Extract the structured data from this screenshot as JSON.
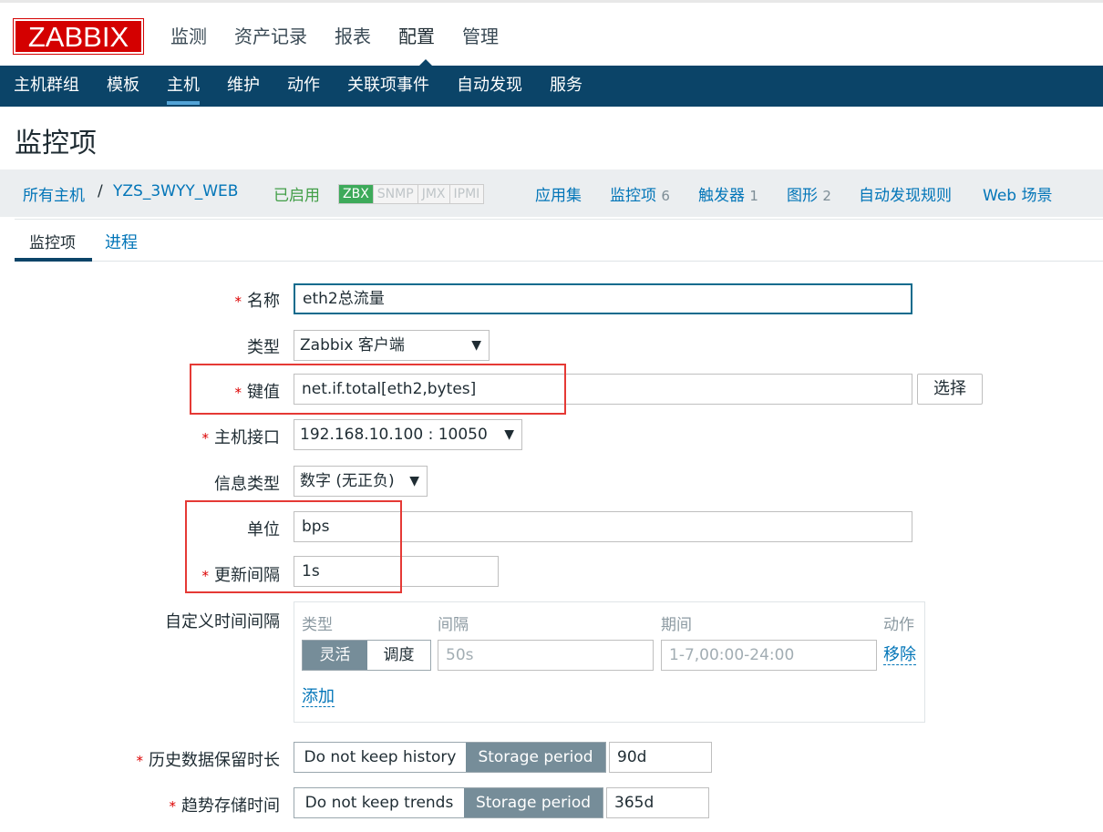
{
  "logo": "ZABBIX",
  "topnav": [
    "监测",
    "资产记录",
    "报表",
    "配置",
    "管理"
  ],
  "subnav": [
    "主机群组",
    "模板",
    "主机",
    "维护",
    "动作",
    "关联项事件",
    "自动发现",
    "服务"
  ],
  "page_title": "监控项",
  "breadcrumb": {
    "all_hosts": "所有主机",
    "sep": "/",
    "host": "YZS_3WYY_WEB",
    "enabled": "已启用",
    "badges": [
      "ZBX",
      "SNMP",
      "JMX",
      "IPMI"
    ],
    "apps": "应用集",
    "items": "监控项",
    "items_count": "6",
    "triggers": "触发器",
    "triggers_count": "1",
    "graphs": "图形",
    "graphs_count": "2",
    "discovery": "自动发现规则",
    "web": "Web 场景"
  },
  "tabs": {
    "item": "监控项",
    "process": "进程"
  },
  "form": {
    "name_label": "名称",
    "name_value": "eth2总流量",
    "type_label": "类型",
    "type_value": "Zabbix 客户端",
    "key_label": "键值",
    "key_value": "net.if.total[eth2,bytes]",
    "select_button": "选择",
    "iface_label": "主机接口",
    "iface_value": "192.168.10.100 : 10050",
    "info_label": "信息类型",
    "info_value": "数字 (无正负)",
    "unit_label": "单位",
    "unit_value": "bps",
    "interval_label": "更新间隔",
    "interval_value": "1s",
    "custom_label": "自定义时间间隔",
    "custom": {
      "col_type": "类型",
      "col_interval": "间隔",
      "col_period": "期间",
      "col_action": "动作",
      "flex": "灵活",
      "sched": "调度",
      "interval_ph": "50s",
      "period_ph": "1-7,00:00-24:00",
      "remove": "移除",
      "add": "添加"
    },
    "history_label": "历史数据保留时长",
    "history_no": "Do not keep history",
    "history_storage": "Storage period",
    "history_value": "90d",
    "trends_label": "趋势存储时间",
    "trends_no": "Do not keep trends",
    "trends_storage": "Storage period",
    "trends_value": "365d",
    "required_mark": "*"
  }
}
